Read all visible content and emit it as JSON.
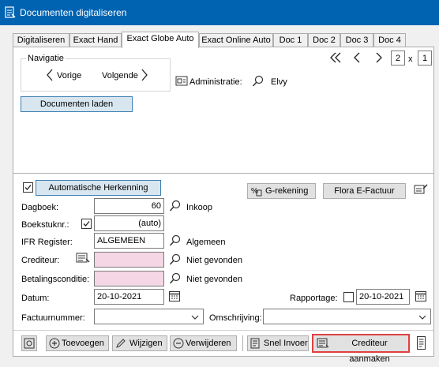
{
  "window": {
    "title": "Documenten digitaliseren"
  },
  "tabs": [
    "Digitaliseren",
    "Exact Hand",
    "Exact Globe Auto",
    "Exact Online Auto",
    "Doc 1",
    "Doc 2",
    "Doc 3",
    "Doc 4"
  ],
  "nav": {
    "group_label": "Navigatie",
    "prev": "Vorige",
    "next": "Volgende",
    "page_current": "2",
    "page_sep": "x",
    "page_total": "1"
  },
  "admin": {
    "label": "Administratie:",
    "value": "Elvy"
  },
  "load_button": "Documenten laden",
  "form": {
    "auto_recognition_button": "Automatische Herkenning",
    "g_account_button": "G-rekening",
    "flora_button": "Flora E-Factuur",
    "dagboek": {
      "label": "Dagboek:",
      "value": "60",
      "lookup": "Inkoop"
    },
    "boekstuk": {
      "label": "Boekstuknr.:",
      "value": "(auto)"
    },
    "ifr": {
      "label": "IFR Register:",
      "value": "ALGEMEEN",
      "lookup": "Algemeen"
    },
    "crediteur": {
      "label": "Crediteur:",
      "value": "",
      "lookup": "Niet gevonden"
    },
    "betaling": {
      "label": "Betalingsconditie:",
      "value": "",
      "lookup": "Niet gevonden"
    },
    "datum": {
      "label": "Datum:",
      "value": "20-10-2021"
    },
    "rapportage": {
      "label": "Rapportage:",
      "value": "20-10-2021"
    },
    "factuurnummer": {
      "label": "Factuurnummer:",
      "value": ""
    },
    "omschrijving": {
      "label": "Omschrijving:",
      "value": ""
    }
  },
  "toolbar": {
    "add": "Toevoegen",
    "edit": "Wijzigen",
    "delete": "Verwijderen",
    "quick_entry": "Snel Invoer",
    "create_creditor": "Crediteur aanmaken"
  },
  "colors": {
    "titlebar": "#0063b1",
    "highlight_border": "#e04040",
    "pink_field": "#f4d6e4"
  }
}
